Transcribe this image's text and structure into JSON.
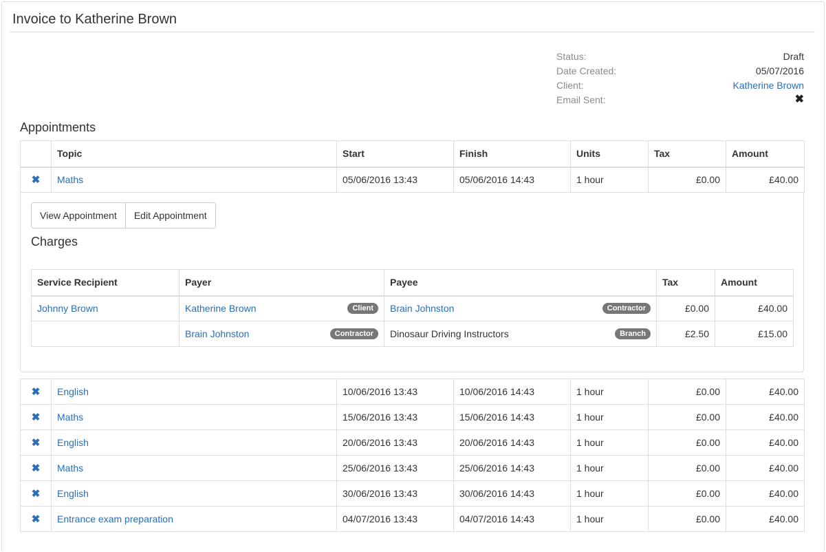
{
  "page": {
    "title": "Invoice to Katherine Brown"
  },
  "meta": {
    "status_label": "Status:",
    "status_value": "Draft",
    "created_label": "Date Created:",
    "created_value": "05/07/2016",
    "client_label": "Client:",
    "client_value": "Katherine Brown",
    "email_label": "Email Sent:",
    "email_value": "✖",
    "email_icon": "cross-icon"
  },
  "appointments": {
    "heading": "Appointments",
    "columns": {
      "topic": "Topic",
      "start": "Start",
      "finish": "Finish",
      "units": "Units",
      "tax": "Tax",
      "amount": "Amount"
    },
    "delete_icon": "✖",
    "first": {
      "topic": "Maths",
      "start": "05/06/2016 13:43",
      "finish": "05/06/2016 14:43",
      "units": "1 hour",
      "tax": "£0.00",
      "amount": "£40.00"
    },
    "rows": [
      {
        "topic": "English",
        "start": "10/06/2016 13:43",
        "finish": "10/06/2016 14:43",
        "units": "1 hour",
        "tax": "£0.00",
        "amount": "£40.00"
      },
      {
        "topic": "Maths",
        "start": "15/06/2016 13:43",
        "finish": "15/06/2016 14:43",
        "units": "1 hour",
        "tax": "£0.00",
        "amount": "£40.00"
      },
      {
        "topic": "English",
        "start": "20/06/2016 13:43",
        "finish": "20/06/2016 14:43",
        "units": "1 hour",
        "tax": "£0.00",
        "amount": "£40.00"
      },
      {
        "topic": "Maths",
        "start": "25/06/2016 13:43",
        "finish": "25/06/2016 14:43",
        "units": "1 hour",
        "tax": "£0.00",
        "amount": "£40.00"
      },
      {
        "topic": "English",
        "start": "30/06/2016 13:43",
        "finish": "30/06/2016 14:43",
        "units": "1 hour",
        "tax": "£0.00",
        "amount": "£40.00"
      },
      {
        "topic": "Entrance exam preparation",
        "start": "04/07/2016 13:43",
        "finish": "04/07/2016 14:43",
        "units": "1 hour",
        "tax": "£0.00",
        "amount": "£40.00"
      }
    ]
  },
  "detail": {
    "view_button": "View Appointment",
    "edit_button": "Edit Appointment",
    "charges_heading": "Charges",
    "columns": {
      "recipient": "Service Recipient",
      "payer": "Payer",
      "payee": "Payee",
      "tax": "Tax",
      "amount": "Amount"
    },
    "charges": [
      {
        "recipient": "Johnny Brown",
        "payer": "Katherine Brown",
        "payer_badge": "Client",
        "payee": "Brain Johnston",
        "payee_badge": "Contractor",
        "tax": "£0.00",
        "amount": "£40.00"
      },
      {
        "recipient": "",
        "payer": "Brain Johnston",
        "payer_badge": "Contractor",
        "payee": "Dinosaur Driving Instructors",
        "payee_badge": "Branch",
        "tax": "£2.50",
        "amount": "£15.00"
      }
    ]
  }
}
